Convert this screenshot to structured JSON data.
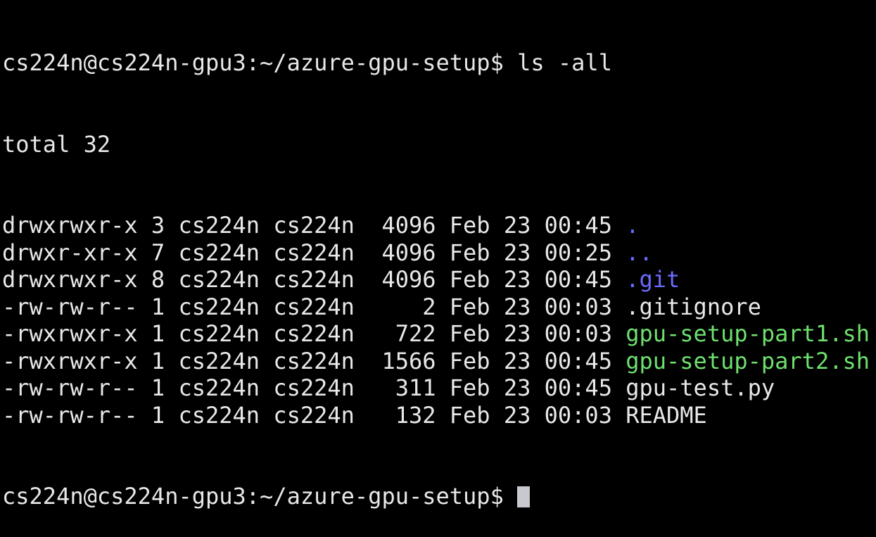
{
  "terminal": {
    "prompt": "cs224n@cs224n-gpu3:~/azure-gpu-setup$",
    "command": "ls -all",
    "total": "total 32",
    "colors": {
      "text": "#e8e8e8",
      "directory": "#6b6bff",
      "executable": "#6ee06e",
      "background": "#000000"
    },
    "entries": [
      {
        "perms": "drwxrwxr-x",
        "links": "3",
        "owner": "cs224n",
        "group": "cs224n",
        "size": "4096",
        "date": "Feb 23",
        "time": "00:45",
        "name": ".",
        "type": "directory"
      },
      {
        "perms": "drwxr-xr-x",
        "links": "7",
        "owner": "cs224n",
        "group": "cs224n",
        "size": "4096",
        "date": "Feb 23",
        "time": "00:25",
        "name": "..",
        "type": "directory"
      },
      {
        "perms": "drwxrwxr-x",
        "links": "8",
        "owner": "cs224n",
        "group": "cs224n",
        "size": "4096",
        "date": "Feb 23",
        "time": "00:45",
        "name": ".git",
        "type": "directory"
      },
      {
        "perms": "-rw-rw-r--",
        "links": "1",
        "owner": "cs224n",
        "group": "cs224n",
        "size": "2",
        "date": "Feb 23",
        "time": "00:03",
        "name": ".gitignore",
        "type": "file"
      },
      {
        "perms": "-rwxrwxr-x",
        "links": "1",
        "owner": "cs224n",
        "group": "cs224n",
        "size": "722",
        "date": "Feb 23",
        "time": "00:03",
        "name": "gpu-setup-part1.sh",
        "type": "executable"
      },
      {
        "perms": "-rwxrwxr-x",
        "links": "1",
        "owner": "cs224n",
        "group": "cs224n",
        "size": "1566",
        "date": "Feb 23",
        "time": "00:45",
        "name": "gpu-setup-part2.sh",
        "type": "executable"
      },
      {
        "perms": "-rw-rw-r--",
        "links": "1",
        "owner": "cs224n",
        "group": "cs224n",
        "size": "311",
        "date": "Feb 23",
        "time": "00:45",
        "name": "gpu-test.py",
        "type": "file"
      },
      {
        "perms": "-rw-rw-r--",
        "links": "1",
        "owner": "cs224n",
        "group": "cs224n",
        "size": "132",
        "date": "Feb 23",
        "time": "00:03",
        "name": "README",
        "type": "file"
      }
    ]
  }
}
